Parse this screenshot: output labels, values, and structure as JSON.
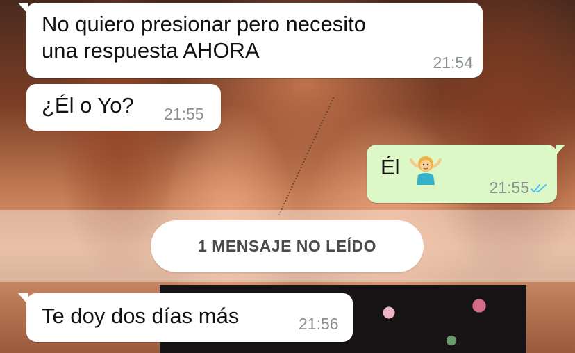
{
  "messages": [
    {
      "direction": "incoming",
      "text": "No quiero presionar pero necesito\nuna respuesta AHORA",
      "time": "21:54"
    },
    {
      "direction": "incoming",
      "text": "¿Él o Yo?",
      "time": "21:55"
    },
    {
      "direction": "outgoing",
      "text": "Él",
      "emoji": "person-shrugging-emoji",
      "time": "21:55",
      "status": "read",
      "status_icon": "double-check-icon"
    },
    {
      "direction": "incoming",
      "text": "Te doy dos días más",
      "time": "21:56"
    }
  ],
  "unread_divider": {
    "label": "1 MENSAJE NO LEÍDO"
  },
  "colors": {
    "incoming_bubble": "#ffffff",
    "outgoing_bubble": "#dcf8c6",
    "timestamp": "#8a8f92",
    "read_ticks": "#4fc3f7"
  }
}
